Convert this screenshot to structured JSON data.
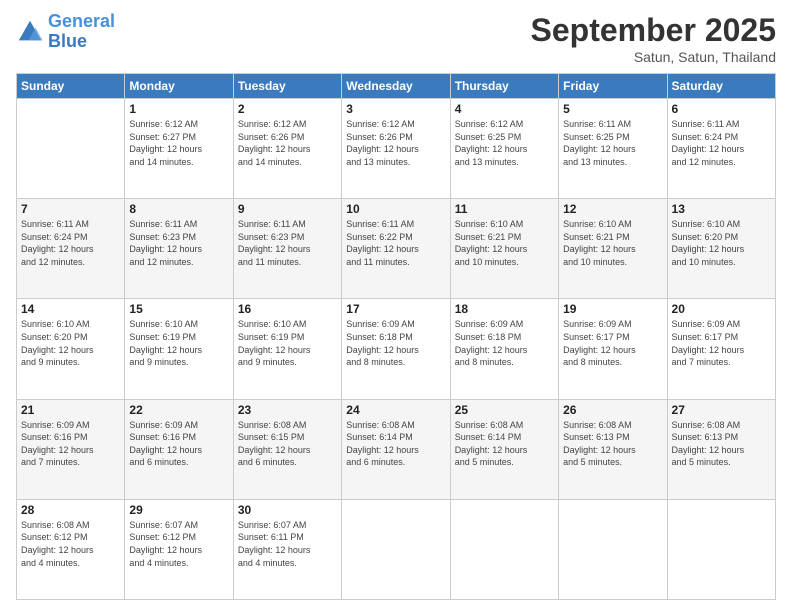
{
  "logo": {
    "line1": "General",
    "line2": "Blue"
  },
  "header": {
    "month": "September 2025",
    "location": "Satun, Satun, Thailand"
  },
  "weekdays": [
    "Sunday",
    "Monday",
    "Tuesday",
    "Wednesday",
    "Thursday",
    "Friday",
    "Saturday"
  ],
  "weeks": [
    [
      {
        "day": "",
        "info": ""
      },
      {
        "day": "1",
        "info": "Sunrise: 6:12 AM\nSunset: 6:27 PM\nDaylight: 12 hours\nand 14 minutes."
      },
      {
        "day": "2",
        "info": "Sunrise: 6:12 AM\nSunset: 6:26 PM\nDaylight: 12 hours\nand 14 minutes."
      },
      {
        "day": "3",
        "info": "Sunrise: 6:12 AM\nSunset: 6:26 PM\nDaylight: 12 hours\nand 13 minutes."
      },
      {
        "day": "4",
        "info": "Sunrise: 6:12 AM\nSunset: 6:25 PM\nDaylight: 12 hours\nand 13 minutes."
      },
      {
        "day": "5",
        "info": "Sunrise: 6:11 AM\nSunset: 6:25 PM\nDaylight: 12 hours\nand 13 minutes."
      },
      {
        "day": "6",
        "info": "Sunrise: 6:11 AM\nSunset: 6:24 PM\nDaylight: 12 hours\nand 12 minutes."
      }
    ],
    [
      {
        "day": "7",
        "info": "Sunrise: 6:11 AM\nSunset: 6:24 PM\nDaylight: 12 hours\nand 12 minutes."
      },
      {
        "day": "8",
        "info": "Sunrise: 6:11 AM\nSunset: 6:23 PM\nDaylight: 12 hours\nand 12 minutes."
      },
      {
        "day": "9",
        "info": "Sunrise: 6:11 AM\nSunset: 6:23 PM\nDaylight: 12 hours\nand 11 minutes."
      },
      {
        "day": "10",
        "info": "Sunrise: 6:11 AM\nSunset: 6:22 PM\nDaylight: 12 hours\nand 11 minutes."
      },
      {
        "day": "11",
        "info": "Sunrise: 6:10 AM\nSunset: 6:21 PM\nDaylight: 12 hours\nand 10 minutes."
      },
      {
        "day": "12",
        "info": "Sunrise: 6:10 AM\nSunset: 6:21 PM\nDaylight: 12 hours\nand 10 minutes."
      },
      {
        "day": "13",
        "info": "Sunrise: 6:10 AM\nSunset: 6:20 PM\nDaylight: 12 hours\nand 10 minutes."
      }
    ],
    [
      {
        "day": "14",
        "info": "Sunrise: 6:10 AM\nSunset: 6:20 PM\nDaylight: 12 hours\nand 9 minutes."
      },
      {
        "day": "15",
        "info": "Sunrise: 6:10 AM\nSunset: 6:19 PM\nDaylight: 12 hours\nand 9 minutes."
      },
      {
        "day": "16",
        "info": "Sunrise: 6:10 AM\nSunset: 6:19 PM\nDaylight: 12 hours\nand 9 minutes."
      },
      {
        "day": "17",
        "info": "Sunrise: 6:09 AM\nSunset: 6:18 PM\nDaylight: 12 hours\nand 8 minutes."
      },
      {
        "day": "18",
        "info": "Sunrise: 6:09 AM\nSunset: 6:18 PM\nDaylight: 12 hours\nand 8 minutes."
      },
      {
        "day": "19",
        "info": "Sunrise: 6:09 AM\nSunset: 6:17 PM\nDaylight: 12 hours\nand 8 minutes."
      },
      {
        "day": "20",
        "info": "Sunrise: 6:09 AM\nSunset: 6:17 PM\nDaylight: 12 hours\nand 7 minutes."
      }
    ],
    [
      {
        "day": "21",
        "info": "Sunrise: 6:09 AM\nSunset: 6:16 PM\nDaylight: 12 hours\nand 7 minutes."
      },
      {
        "day": "22",
        "info": "Sunrise: 6:09 AM\nSunset: 6:16 PM\nDaylight: 12 hours\nand 6 minutes."
      },
      {
        "day": "23",
        "info": "Sunrise: 6:08 AM\nSunset: 6:15 PM\nDaylight: 12 hours\nand 6 minutes."
      },
      {
        "day": "24",
        "info": "Sunrise: 6:08 AM\nSunset: 6:14 PM\nDaylight: 12 hours\nand 6 minutes."
      },
      {
        "day": "25",
        "info": "Sunrise: 6:08 AM\nSunset: 6:14 PM\nDaylight: 12 hours\nand 5 minutes."
      },
      {
        "day": "26",
        "info": "Sunrise: 6:08 AM\nSunset: 6:13 PM\nDaylight: 12 hours\nand 5 minutes."
      },
      {
        "day": "27",
        "info": "Sunrise: 6:08 AM\nSunset: 6:13 PM\nDaylight: 12 hours\nand 5 minutes."
      }
    ],
    [
      {
        "day": "28",
        "info": "Sunrise: 6:08 AM\nSunset: 6:12 PM\nDaylight: 12 hours\nand 4 minutes."
      },
      {
        "day": "29",
        "info": "Sunrise: 6:07 AM\nSunset: 6:12 PM\nDaylight: 12 hours\nand 4 minutes."
      },
      {
        "day": "30",
        "info": "Sunrise: 6:07 AM\nSunset: 6:11 PM\nDaylight: 12 hours\nand 4 minutes."
      },
      {
        "day": "",
        "info": ""
      },
      {
        "day": "",
        "info": ""
      },
      {
        "day": "",
        "info": ""
      },
      {
        "day": "",
        "info": ""
      }
    ]
  ]
}
